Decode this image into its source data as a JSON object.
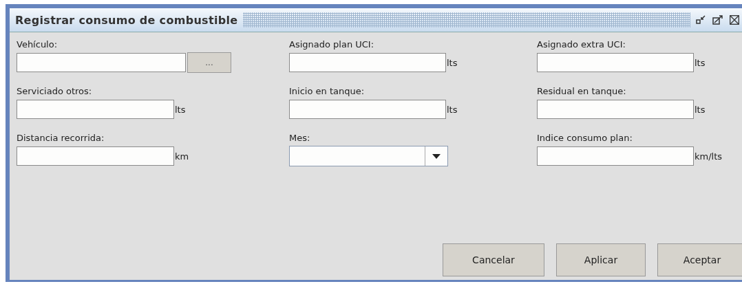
{
  "window": {
    "title": "Registrar consumo de combustible"
  },
  "fields": [
    {
      "kind": "browse",
      "label": "Vehículo:",
      "button": "..."
    },
    {
      "kind": "unit",
      "label": "Asignado plan UCI:",
      "unit": "lts"
    },
    {
      "kind": "unit",
      "label": "Asignado extra UCI:",
      "unit": "lts"
    },
    {
      "kind": "unit",
      "label": "Serviciado otros:",
      "unit": "lts"
    },
    {
      "kind": "unit",
      "label": "Inicio en tanque:",
      "unit": "lts"
    },
    {
      "kind": "unit",
      "label": "Residual en tanque:",
      "unit": "lts"
    },
    {
      "kind": "unit",
      "label": "Distancia recorrida:",
      "unit": "km"
    },
    {
      "kind": "combo",
      "label": "Mes:"
    },
    {
      "kind": "unit",
      "label": "Indice consumo plan:",
      "unit": "km/lts"
    }
  ],
  "buttons": [
    "Cancelar",
    "Aplicar",
    "Aceptar"
  ]
}
